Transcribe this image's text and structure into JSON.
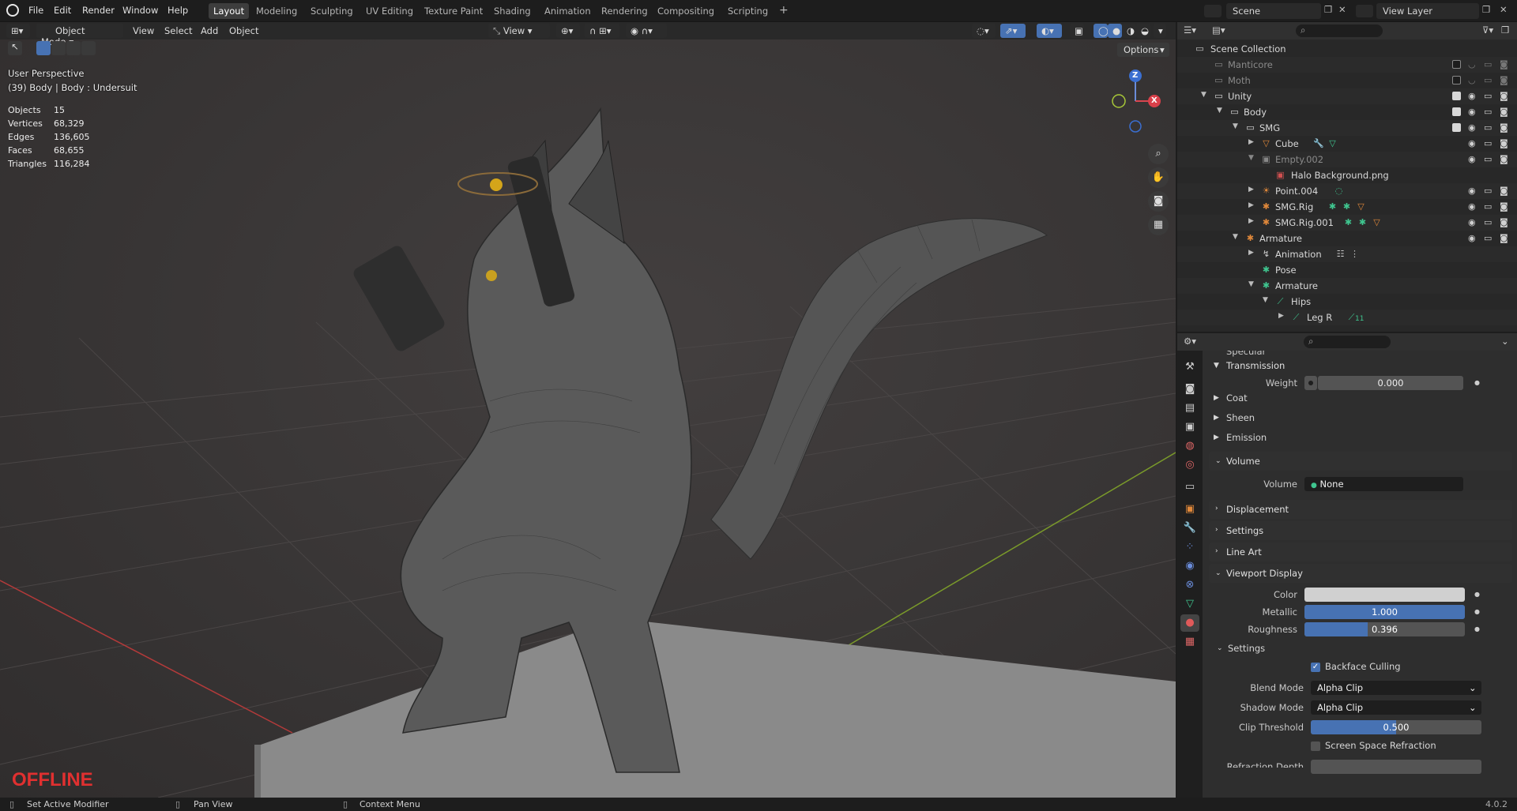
{
  "menus": [
    "File",
    "Edit",
    "Render",
    "Window",
    "Help"
  ],
  "workspaces": [
    "Layout",
    "Modeling",
    "Sculpting",
    "UV Editing",
    "Texture Paint",
    "Shading",
    "Animation",
    "Rendering",
    "Compositing",
    "Scripting"
  ],
  "active_workspace": "Layout",
  "scene": {
    "label": "Scene",
    "view_layer": "View Layer"
  },
  "viewport": {
    "mode": "Object Mode",
    "menus": [
      "View",
      "Select",
      "Add",
      "Object"
    ],
    "transform_orientation": "View",
    "options_label": "Options",
    "perspective": "User Perspective",
    "context": "(39) Body | Body : Undersuit",
    "stats": [
      {
        "label": "Objects",
        "value": "15"
      },
      {
        "label": "Vertices",
        "value": "68,329"
      },
      {
        "label": "Edges",
        "value": "136,605"
      },
      {
        "label": "Faces",
        "value": "68,655"
      },
      {
        "label": "Triangles",
        "value": "116,284"
      }
    ],
    "gizmo": {
      "z": "Z",
      "x": "X"
    },
    "offline": "OFFLINE"
  },
  "outliner": {
    "root": "Scene Collection",
    "rows": [
      {
        "label": "Manticore"
      },
      {
        "label": "Moth"
      },
      {
        "label": "Unity"
      },
      {
        "label": "Body"
      },
      {
        "label": "SMG"
      },
      {
        "label": "Cube"
      },
      {
        "label": "Empty.002"
      },
      {
        "label": "Halo Background.png"
      },
      {
        "label": "Point.004"
      },
      {
        "label": "SMG.Rig"
      },
      {
        "label": "SMG.Rig.001"
      },
      {
        "label": "Armature"
      },
      {
        "label": "Animation"
      },
      {
        "label": "Pose"
      },
      {
        "label": "Armature"
      },
      {
        "label": "Hips"
      },
      {
        "label": "Leg R"
      }
    ],
    "leg_badge": "11"
  },
  "properties": {
    "specular": "Specular",
    "transmission": "Transmission",
    "weight_label": "Weight",
    "weight_value": "0.000",
    "coat": "Coat",
    "sheen": "Sheen",
    "emission": "Emission",
    "volume": "Volume",
    "volume_label": "Volume",
    "volume_value": "None",
    "displacement": "Displacement",
    "settings": "Settings",
    "line_art": "Line Art",
    "viewport_display": "Viewport Display",
    "color_label": "Color",
    "metallic_label": "Metallic",
    "metallic_value": "1.000",
    "metallic_fill": 1.0,
    "roughness_label": "Roughness",
    "roughness_value": "0.396",
    "roughness_fill": 0.396,
    "settings_sub": "Settings",
    "backface": "Backface Culling",
    "blend_label": "Blend Mode",
    "blend_value": "Alpha Clip",
    "shadow_label": "Shadow Mode",
    "shadow_value": "Alpha Clip",
    "clip_label": "Clip Threshold",
    "clip_value": "0.500",
    "clip_fill": 0.5,
    "ssr": "Screen Space Refraction",
    "refraction_depth": "Refraction Depth"
  },
  "status": {
    "left": "Set Active Modifier",
    "mid": "Pan View",
    "right": "Context Menu",
    "version": "4.0.2"
  },
  "colors": {
    "accent": "#4772b3",
    "offline": "#e03030",
    "green": "#3fc58f",
    "orange": "#e0883a"
  }
}
